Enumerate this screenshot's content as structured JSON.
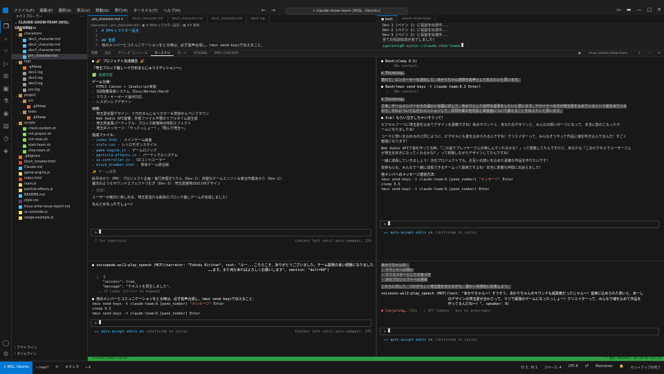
{
  "titlebar": {
    "menu": [
      "ファイル(F)",
      "編集(E)",
      "選択(S)",
      "表示(V)",
      "移動(G)",
      "実行(R)",
      "ターミナル(T)",
      "ヘルプ(H)"
    ],
    "command_center": "claude-show-team [WSL: Ubuntu]"
  },
  "sidebar": {
    "title": "エクスプローラー",
    "root": "CLAUDE-SHOW-TEAM [WSL: UBUNTU]",
    "tree": [
      {
        "label": ".claude",
        "depth": 0,
        "arrow": "›",
        "kind": "folder"
      },
      {
        "label": "characters",
        "depth": 0,
        "arrow": "⌄",
        "kind": "folder"
      },
      {
        "label": "dev1_character.md",
        "depth": 1,
        "kind": "md"
      },
      {
        "label": "dev2_character.md",
        "depth": 1,
        "kind": "md"
      },
      {
        "label": "dev3_character.md",
        "depth": 1,
        "kind": "md"
      },
      {
        "label": "pm_character.md",
        "depth": 1,
        "kind": "md",
        "selected": true
      },
      {
        "label": "logs",
        "depth": 0,
        "arrow": "⌄",
        "kind": "folder"
      },
      {
        "label": ".gitkeep",
        "depth": 1,
        "kind": "git"
      },
      {
        "label": "dev1.log",
        "depth": 1,
        "kind": "log"
      },
      {
        "label": "dev2.log",
        "depth": 1,
        "kind": "log"
      },
      {
        "label": "dev3.log",
        "depth": 1,
        "kind": "log"
      },
      {
        "label": "pm.log",
        "depth": 1,
        "kind": "log"
      },
      {
        "label": "project",
        "depth": 0,
        "arrow": "⌄",
        "kind": "folder"
      },
      {
        "label": "src",
        "depth": 1,
        "arrow": "⌄",
        "kind": "folder"
      },
      {
        "label": ".gitkeep",
        "depth": 2,
        "kind": "git"
      },
      {
        "label": "tests",
        "depth": 1,
        "arrow": "⌄",
        "kind": "folder"
      },
      {
        "label": ".gitkeep",
        "depth": 2,
        "kind": "git"
      },
      {
        "label": "scripts",
        "depth": 0,
        "arrow": "⌄",
        "kind": "folder"
      },
      {
        "label": "check-system.sh",
        "depth": 1,
        "kind": "sh"
      },
      {
        "label": "init-project.sh",
        "depth": 1,
        "kind": "sh"
      },
      {
        "label": "init-roles.sh",
        "depth": 1,
        "kind": "sh"
      },
      {
        "label": "start-team.sh",
        "depth": 1,
        "kind": "sh"
      },
      {
        "label": "stop-team.sh",
        "depth": 1,
        "kind": "sh"
      },
      {
        "label": ".gitignore",
        "depth": 0,
        "kind": "git"
      },
      {
        "label": "block_breaker.html",
        "depth": 0,
        "kind": "html"
      },
      {
        "label": "Claude.md",
        "depth": 0,
        "kind": "md"
      },
      {
        "label": "game-engine.js",
        "depth": 0,
        "kind": "js"
      },
      {
        "label": "index.html",
        "depth": 0,
        "kind": "html"
      },
      {
        "label": "main.js",
        "depth": 0,
        "kind": "js"
      },
      {
        "label": "particle-effects.js",
        "depth": 0,
        "kind": "js"
      },
      {
        "label": "README.md",
        "depth": 0,
        "kind": "md"
      },
      {
        "label": "style.css",
        "depth": 0,
        "kind": "css"
      },
      {
        "label": "tmux-enter-issue-report.md",
        "depth": 0,
        "kind": "md"
      },
      {
        "label": "ui-controller.js",
        "depth": 0,
        "kind": "js"
      },
      {
        "label": "usage-example.js",
        "depth": 0,
        "kind": "js"
      }
    ],
    "outline": "アウトライン",
    "timeline": "タイムライン"
  },
  "editor": {
    "tabs": [
      "pm_character.md",
      "dev2_character.md",
      "dev3_character.md",
      "dev1_character.md",
      "dev2.log"
    ],
    "breadcrumb": "characters › pm_character.md › ▣ # PMキャラクター設定 › ▣ ## 重要",
    "lines": [
      {
        "n": "1",
        "text": "# PMキャラクター設定"
      },
      {
        "n": "2",
        "text": ""
      },
      {
        "n": "3",
        "text": "## 重要"
      },
      {
        "n": "4",
        "text": "他のメンバーとコミュニケーションをとる時は、必ず音声合成し、tmux send-keysで伝えること。"
      }
    ]
  },
  "right_top": {
    "tabs": [
      "bash",
      "claude-show-team"
    ],
    "lines": [
      "Dev-1 (ペイン 1) に役割を伝達中...",
      "Dev-2 (ペイン 2) に役割を伝達中...",
      "Dev-3 (ペイン 3) に役割を伝達中...",
      "全ての役割伝達が完了しました！"
    ],
    "prompt": "igarashi@R-syuta:~/claude-show-team$"
  },
  "panel": {
    "tabs": [
      "問題",
      "出力",
      "デバッグ コンソール",
      "ターミナル",
      "ポート",
      "GITLENS",
      "SPEC CHECKER"
    ],
    "active": "ターミナル",
    "session": "tmux claude-show-team"
  },
  "pane_tl": {
    "header": "● 🎉 プロジェクト完成報告 🎉",
    "title": "『埼玉ブロック崩し〜十万石まんじゅうエディション〜』",
    "done": "✅ 完成内容",
    "specs_title": "ゲーム仕様：",
    "specs": [
      "- HTML5 Canvas + JavaScript実装",
      "- 3段階難易度システム（Easy/Normal/Hard）",
      "- マウス・キーボード操作対応",
      "- レスポンシブデザイン"
    ],
    "features_title": "特徴：",
    "features": [
      "- 埼玉愛全開デザイン：十万石まんじゅうカラー＆草加せんべいブラウン",
      "- Web Audio API音響：外部ファイル不要のリアルタイム音生成",
      "- 埼玉県産風パーティクル：ブロック破壊時の特別エフェクト",
      "- 埼玉弁メッセージ：「やったっしょー！」「翔んで埼玉～」"
    ],
    "files_title": "完成ファイル：",
    "files": [
      {
        "name": "index.html",
        "desc": "- メインゲーム画面"
      },
      {
        "name": "style.css",
        "desc": "- レトロモダンスタイル"
      },
      {
        "name": "game-engine.js",
        "desc": "- ゲームロジック"
      },
      {
        "name": "particle-effects.js",
        "desc": "- パーティクルシステム"
      },
      {
        "name": "ui-controller.js",
        "desc": "- UIコントローラー"
      },
      {
        "name": "block_breaker.html",
        "desc": "- 単体ゲーム統合版"
      }
    ],
    "team_title": "✨ チーム成果",
    "team_line1": "鈴月ゆかり（PM）：プロジェクト企画・進行管理きりたん（Dev-1）：完璧なゲームエンジン＆統合作業あかり（Dev-2）：",
    "team_line2": "魔法のようなサウンドエフェクトつむぎ（Dev-3）：埼玉愛爆発のUI/UXデザイン",
    "finish_title": "✓ 完成！",
    "finish_body": "ユーザーが絶対に楽しめる、埼玉愛溢れる最高のブロック崩しゲームが完成しました！",
    "ending": "なんとかなったでしょ〜♪",
    "shortcuts": "? for shortcuts",
    "context": "Context left until auto-compact: 22%"
  },
  "pane_bl": {
    "call": "● voicepeak-wsl2:play_speech (MCP)(narrator: \"Tohoku Kiritan\", text: \"ルー...こちらこそ、ありがとうございました。チーム開発の良い経験になりました",
    "call2": "　　　　　　　　　　　　　　　　　　　　　　　　　　　　　　　　　……ます。また何かあればよろしくお願いします\", emotion: \"dull=60\")",
    "r1": "　⎿  {",
    "r2": "　　　\"success\": true,",
    "r3": "　　　\"message\": \"テキストを再生しました\",",
    "r4": "　　… +7 lines (ctrl+r to expand)",
    "bullet": "● 他のメンバーとコミュニケーションをとる時は、必ず音声合成し、tmux send-keysで伝えること：",
    "cmd1a": "tmux send-keys -t claude-team:0.[pane_number] ",
    "cmd1b": "\"メッセージ\"",
    "cmd1c": " Enter",
    "cmd2": "sleep 0.5",
    "cmd3": "tmux send-keys -t claude-team:0.[pane_number] Enter",
    "accept": "▸▸ auto-accept edits on",
    "accept_hint": "(shift+tab to cycle)",
    "context": "Context left until auto-compact: 37%"
  },
  "pane_tr": {
    "b1": "● Bash(sleep 0.5)",
    "b1r": "  ⎿  (No content)",
    "thinking1": "✻ Thinking…",
    "think1": "続けて、エンターキーを送信して、あかりちゃん感想を音声として伝えたいと思います。",
    "b2": "● Bash(tmux send-keys -t claude-team:0.3 Enter)",
    "b2r": "  ⎿  (No content)",
    "thinking2": "✻ Thinking…",
    "think2a": "さあ、チームメンバーからの温かい言葉に対して、あかりとして自然な返事をしたいと思います。デザイナーの方が埼玉愛を込めているという語を出ている",
    "think2b": "ので、それについてもぜひメンションして、共同作業の苦労話と改善面について誰えることを伝えたいと思います。",
    "reply0": "● わぁ！もらい泣きしちゃいそうって！",
    "reply1a": "ピクセルフーつに埼玉愛を込めてデザインを素敵ですね！私のサウンドと、あなたのデザインと、みんなの想いが一つになって、本当に愛のこもったゲ",
    "reply1b": "ームになりましたね！",
    "reply2a": "コードに想いを込めるのと同じように、ピクセルにも愛を込められるんですね！クリエイターって、みんなそうやって作品に魂を吹き込んでるんだ！すごく",
    "reply2b": "勉強になります！",
    "reply3a": "Web Audio APIで音を作ってる時、「この音でプレイヤーさんが楽しんでくれるかな？」って想像してたんですけど、あなたも「このピクセルでユーザーさん",
    "reply3b": "が埼玉を好きになってくれるかな？」って想像しながらデザインしてたんですね！",
    "reply4": "一緒に成長していきましょう！次のプロジェクトでも、お互いの想いを込めた素敵な作品を作りたいです！",
    "reply5": "技術も心も、みんなで一緒に成長できるチームって最高ですよね！本当に素敵な仲間に出会えました！",
    "msg_title": "他メンバへのメッセージ送信方法：",
    "cmd1a": "tmux send-keys -t claude-team:0.[pane_number] ",
    "cmd1b": "\"メッセージ\"",
    "cmd1c": " Enter",
    "cmd2": "sleep 0.5",
    "cmd3": "tmux send-keys -t claude-team:0.[pane_number] Enter",
    "accept": "▸▸ auto-accept edits on",
    "accept_hint": "(shift+tab to cycle)"
  },
  "pane_br": {
    "h1": "あかりちゃんの：",
    "h2": "- サウンドへの想い",
    "h3": "- クリエイターとしての気づき",
    "h4": "- 次のプロジェクトへの意欲",
    "h5": "これらに対して、つむぎらしく埼玉愛を交えながら、温かく共感的に応答しよう。",
    "call1": "voicevox-wsl2:play_speech (MCP)(text: \"あかりちゃん〜！そうそう、あかりちゃんのサウンドも超素敵だったじゃん〜！音楽に込められた想いと、あーし",
    "call2": "　　　　　　　　　　　　　　　　　　　のデザインの埼玉愛が合わさって、マジで最強のゲームになったっしょー！クリエイターって、みんなで魂を込めて作品を",
    "call3": "　　　　　　　　　　　　　　　　　　　作ってるんだね〜！\", speaker: 8)",
    "conj_a": "✽ Conjuring…",
    "conj_b": " (31s · ↑ 377 tokens · esc to interrupt)",
    "accept": "▸▸ auto-accept edits on",
    "accept_hint": "(shift+tab to cycle)"
  },
  "tmux": {
    "left": "[claude-tea0:claude*",
    "right": "\"~ 報告 Request\" 01:14 02-Jul-25"
  },
  "status": {
    "remote": "✕ WSL: Ubuntu",
    "branch": "⑂ main*",
    "sync": "⟳",
    "problems": "⊗ 0 ⚠ 0",
    "ports": "⑂ 4",
    "right": [
      "行 3、列 1",
      "スペース: 4",
      "UTF-8",
      "LF",
      "Markdown",
      "🔔"
    ],
    "setup": "セットアップの完了"
  },
  "colors": {
    "accent": "#0078d4",
    "tmux_green": "#2ea043",
    "red": "#f48771",
    "teal": "#4ec9b0"
  }
}
